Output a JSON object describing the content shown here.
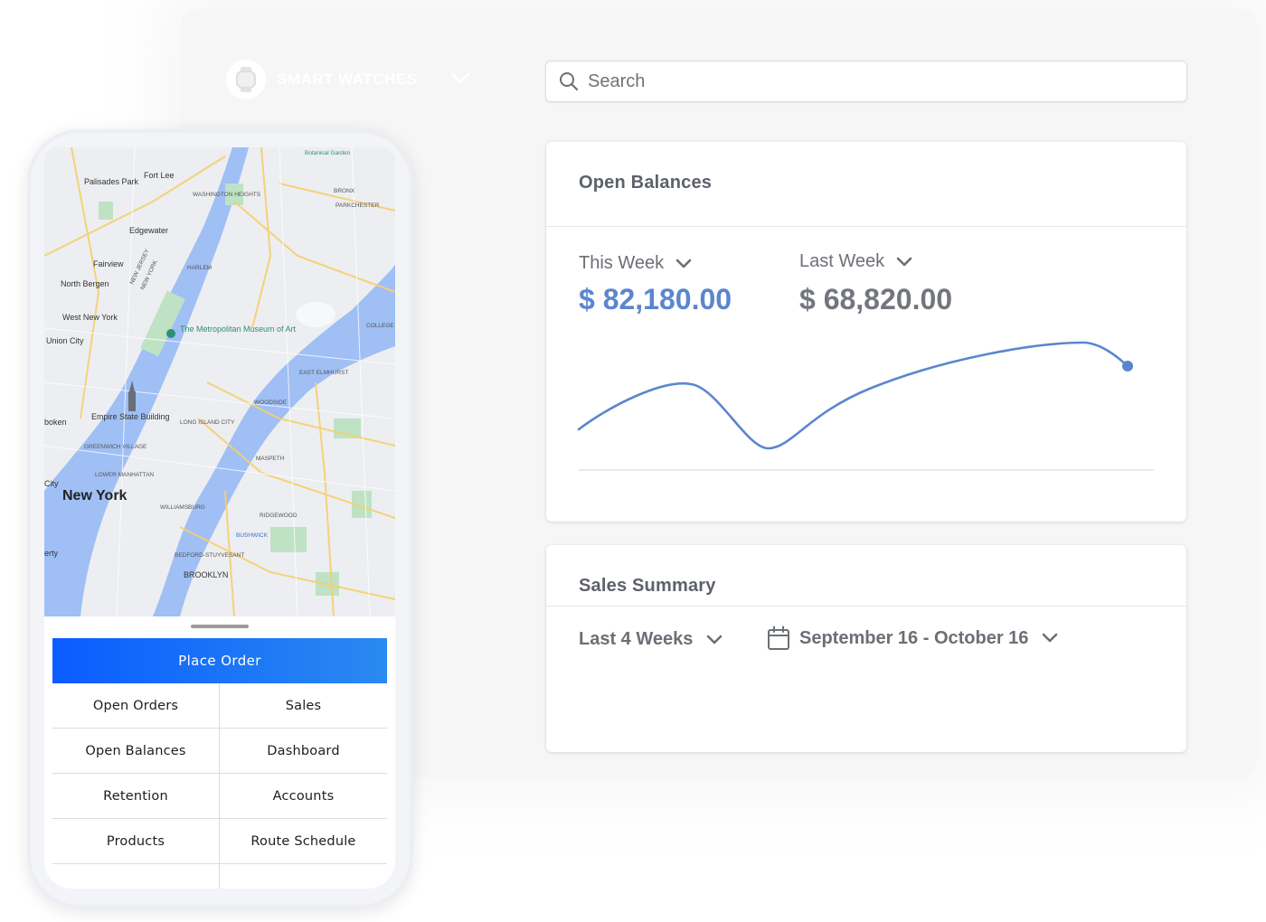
{
  "brand": {
    "name": "SMART WATCHES",
    "logo_icon": "watch-icon"
  },
  "search": {
    "placeholder": "Search",
    "value": ""
  },
  "open_balances": {
    "title": "Open Balances",
    "this_week": {
      "label": "This Week",
      "amount": "$ 82,180.00",
      "color": "#5b86cf"
    },
    "last_week": {
      "label": "Last Week",
      "amount": "$ 68,820.00",
      "color": "#73767c"
    }
  },
  "sales_summary": {
    "title": "Sales Summary",
    "range_select": "Last 4 Weeks",
    "date_range": "September 16 - October 16"
  },
  "map": {
    "city_label": "New York",
    "places": [
      "Fort Lee",
      "Palisades Park",
      "Edgewater",
      "Fairview",
      "North Bergen",
      "West New York",
      "Union City",
      "Empire State Building",
      "The Metropolitan Museum of Art",
      "HARLEM",
      "WASHINGTON HEIGHTS",
      "BRONX",
      "PARKCHESTER",
      "Botanical Garden",
      "EAST ELMHURST",
      "WOODSIDE",
      "LONG ISLAND CITY",
      "MASPETH",
      "GREENWICH VILLAGE",
      "LOWER MANHATTAN",
      "WILLIAMSBURG",
      "RIDGEWOOD",
      "BUSHWICK",
      "BEDFORD-STUYVESANT",
      "BROOKLYN",
      "COLLEGE",
      "NEW JERSEY",
      "NEW YORK",
      "boken",
      "City",
      "erty"
    ]
  },
  "mobile": {
    "primary_action": "Place Order",
    "menu": [
      [
        "Open Orders",
        "Sales"
      ],
      [
        "Open Balances",
        "Dashboard"
      ],
      [
        "Retention",
        "Accounts"
      ],
      [
        "Products",
        "Route Schedule"
      ]
    ]
  },
  "colors": {
    "accent": "#5b86cf",
    "button_start": "#0a5cff",
    "button_end": "#2a8af0"
  }
}
